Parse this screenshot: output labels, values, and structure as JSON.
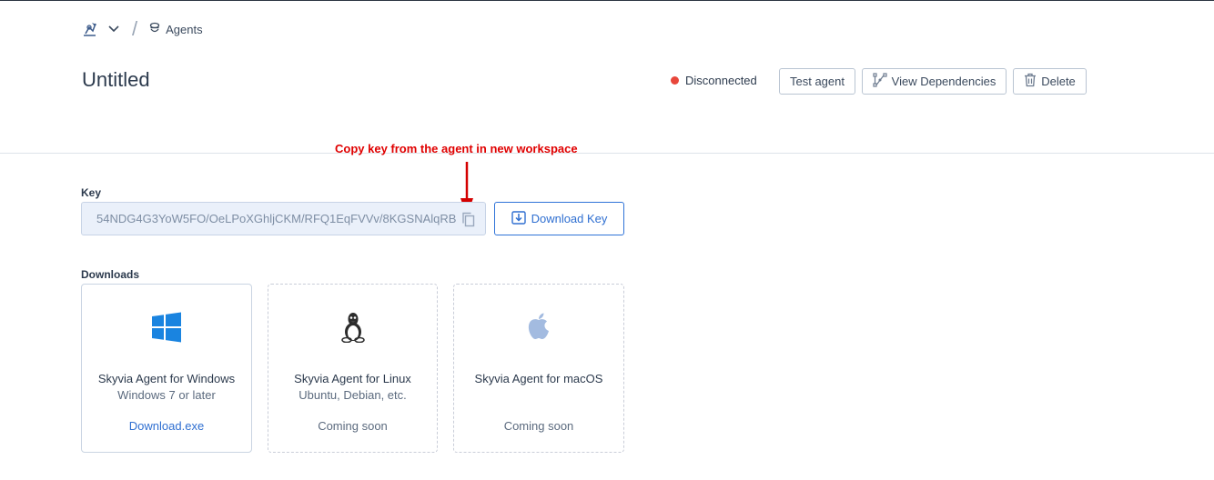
{
  "breadcrumb": {
    "workspace_icon": "workspace-logo-icon",
    "separator": "/",
    "agents_label": "Agents"
  },
  "page": {
    "title": "Untitled"
  },
  "status": {
    "label": "Disconnected",
    "color": "#e8473b"
  },
  "toolbar": {
    "test_label": "Test agent",
    "dependencies_label": "View Dependencies",
    "delete_label": "Delete"
  },
  "annotation": {
    "text": "Copy key from the agent in new workspace",
    "color": "#e00000"
  },
  "key": {
    "label": "Key",
    "value": "54NDG4G3YoW5FO/OeLPoXGhljCKM/RFQ1EqFVVv/8KGSNAlqRB",
    "download_label": "Download Key"
  },
  "downloads": {
    "label": "Downloads",
    "cards": [
      {
        "icon": "windows-icon",
        "title": "Skyvia Agent for Windows",
        "subtitle": "Windows 7 or later",
        "action": "Download.exe"
      },
      {
        "icon": "linux-tux-icon",
        "title": "Skyvia Agent for Linux",
        "subtitle": "Ubuntu, Debian, etc.",
        "action": "Coming soon"
      },
      {
        "icon": "apple-icon",
        "title": "Skyvia Agent for macOS",
        "subtitle": "",
        "action": "Coming soon"
      }
    ]
  },
  "colors": {
    "accent": "#2f6fd1",
    "text": "#2c3a4d",
    "border": "#c9d4e2"
  }
}
